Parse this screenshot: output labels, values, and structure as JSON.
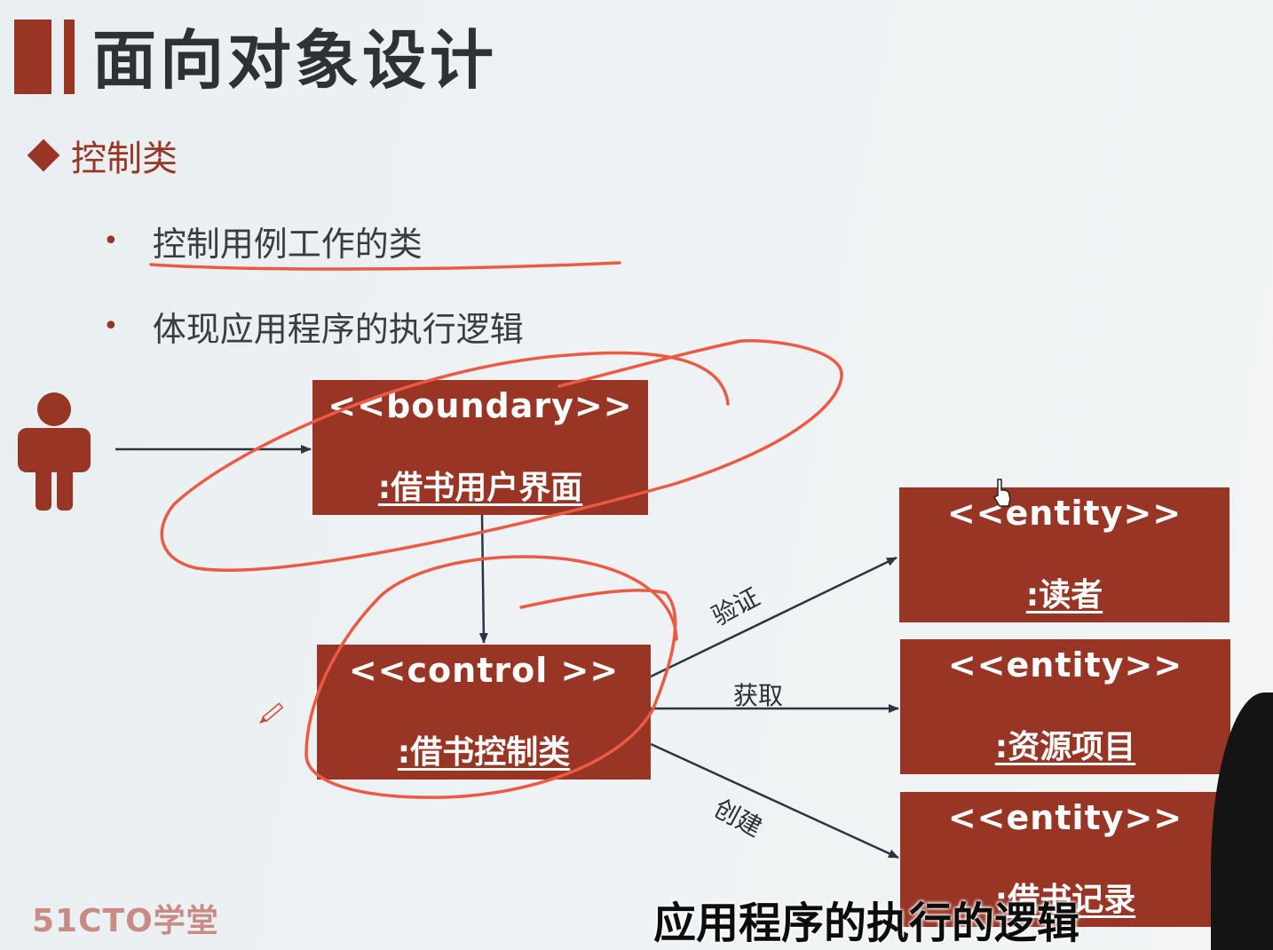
{
  "title": "面向对象设计",
  "section": {
    "label": "控制类"
  },
  "bullets": [
    {
      "text": "控制用例工作的类"
    },
    {
      "text": "体现应用程序的执行逻辑"
    }
  ],
  "diagram": {
    "boundary": {
      "stereotype": "<<boundary>>",
      "name": ":借书用户界面"
    },
    "control": {
      "stereotype": "<<control >>",
      "name": ":借书控制类"
    },
    "entities": [
      {
        "stereotype": "<<entity>>",
        "name": ":读者"
      },
      {
        "stereotype": "<<entity>>",
        "name": ":资源项目"
      },
      {
        "stereotype": "<<entity>>",
        "name": ":借书记录"
      }
    ],
    "edge_labels": {
      "verify": "验证",
      "get": "获取",
      "create": "创建"
    },
    "colors": {
      "box": "#983524",
      "annotation": "#ec5a43",
      "arrow": "#2b3440"
    }
  },
  "footer": {
    "brand": "51CTO学堂"
  },
  "subtitle": "应用程序的执行的逻辑",
  "icons": [
    "actor-icon",
    "cursor-hand-icon",
    "pen-icon"
  ]
}
